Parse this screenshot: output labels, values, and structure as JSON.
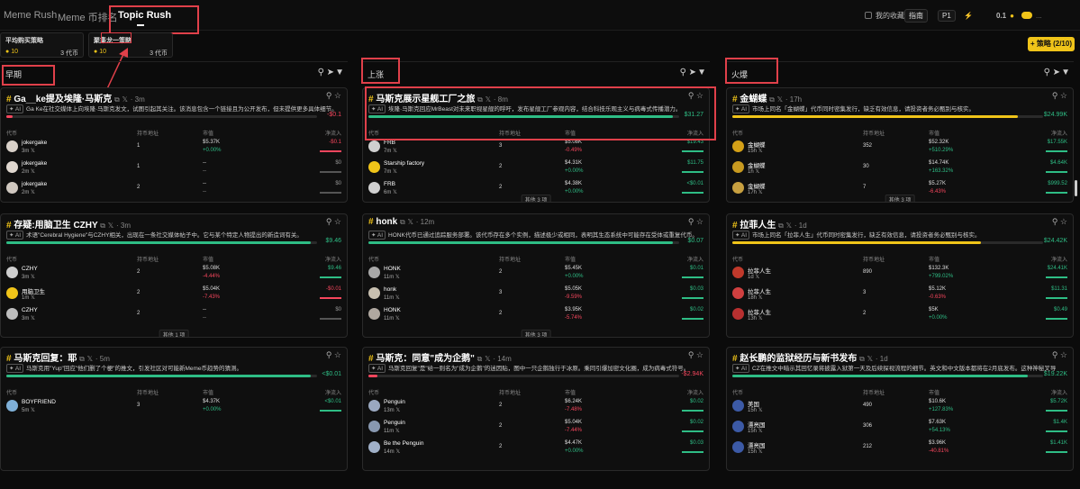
{
  "tabs": [
    {
      "label": "Meme Rush"
    },
    {
      "label": "Meme 币排名"
    },
    {
      "label": "Topic Rush"
    }
  ],
  "topright": {
    "fav": "我的收藏",
    "guide": "指南",
    "p1": "P1",
    "amount": "0.1",
    "toggle": "..."
  },
  "strategies": [
    {
      "name": "平均购买策略",
      "count": "10",
      "label": "3 代币"
    },
    {
      "name": "聚集龙一策略",
      "count": "10",
      "label": "3 代币"
    }
  ],
  "add_button": "+ 策略 (2/10)",
  "table_headers": [
    "代币",
    "持币地址",
    "市值",
    "净流入"
  ],
  "columns": [
    {
      "title": "早期",
      "cards": [
        {
          "title": "Ga__ke提及埃隆·马斯克",
          "ago": "3m",
          "desc": "Ga Ke在社交媒体上向埃隆·马斯克发文，试图引起其关注。该消息包含一个链接且为公开发布，但未提供更多具体细节。",
          "amount": "-$0.1",
          "amt_class": "down",
          "bar": 0.02,
          "bar_color": "#f6465d",
          "rows": [
            {
              "name": "jokergake",
              "age": "3m",
              "hold": "1",
              "mc": "$5.37K",
              "pct": "+0.00%",
              "pc": "up",
              "net": "-$0.1",
              "nc": "down",
              "av": "#d8d0c8"
            },
            {
              "name": "jokergake",
              "age": "2m",
              "hold": "1",
              "mc": "--",
              "pct": "--",
              "pc": "neu",
              "net": "$0",
              "nc": "neu",
              "av": "#e0d8d0"
            },
            {
              "name": "jokergake",
              "age": "2m",
              "hold": "2",
              "mc": "--",
              "pct": "--",
              "pc": "neu",
              "net": "$0",
              "nc": "neu",
              "av": "#d0c8c0"
            }
          ],
          "more": ""
        },
        {
          "title": "存疑:用脑卫生 CZHY",
          "ago": "3m",
          "desc": "术语\"Cerebral Hygiene\"与CZHY相关，出现在一条社交媒体帖子中。它与某个特定人物提出的新造词有关。",
          "amount": "$9.46",
          "amt_class": "up",
          "bar": 0.98,
          "bar_color": "#2ebd85",
          "rows": [
            {
              "name": "CZHY",
              "age": "3m",
              "hold": "2",
              "mc": "$5.08K",
              "pct": "-4.44%",
              "pc": "down",
              "net": "$9.46",
              "nc": "up",
              "av": "#cfcfcf"
            },
            {
              "name": "用脑卫生",
              "age": "1m",
              "hold": "2",
              "mc": "$5.04K",
              "pct": "-7.43%",
              "pc": "down",
              "net": "-$0.01",
              "nc": "down",
              "av": "#f0c419"
            },
            {
              "name": "CZHY",
              "age": "3m",
              "hold": "2",
              "mc": "--",
              "pct": "--",
              "pc": "neu",
              "net": "$0",
              "nc": "neu",
              "av": "#bdbdbd"
            }
          ],
          "more": "其他 1 项"
        },
        {
          "title": "马斯克回复：耶",
          "ago": "5m",
          "desc": "马斯克用\"Yup\"回应\"他们删了个梗\"的推文，引发社区对可能新Meme币趋势的猜测。",
          "amount": "<$0.01",
          "amt_class": "up",
          "bar": 0.98,
          "bar_color": "#2ebd85",
          "rows": [
            {
              "name": "BOYFRIEND",
              "age": "5m",
              "hold": "3",
              "mc": "$4.37K",
              "pct": "+0.00%",
              "pc": "up",
              "net": "<$0.01",
              "nc": "up",
              "av": "#7fb0d8"
            }
          ],
          "more": ""
        }
      ]
    },
    {
      "title": "上涨",
      "cards": [
        {
          "title": "马斯克展示星舰工厂之旅",
          "ago": "8m",
          "desc": "埃隆·马斯克回应MrBeast对未来职视星舰的呼吁，发布星舰工厂参观内容，结合科技乐观主义与病毒式传播潜力。",
          "amount": "$31.27",
          "amt_class": "up",
          "bar": 0.98,
          "bar_color": "#2ebd85",
          "rows": [
            {
              "name": "FRB",
              "age": "7m",
              "hold": "3",
              "mc": "$5.08K",
              "pct": "-0.49%",
              "pc": "down",
              "net": "$19.43",
              "nc": "up",
              "av": "#cfcfcf"
            },
            {
              "name": "Starship factory",
              "age": "7m",
              "hold": "2",
              "mc": "$4.31K",
              "pct": "+0.00%",
              "pc": "up",
              "net": "$11.75",
              "nc": "up",
              "av": "#f0c419"
            },
            {
              "name": "FRB",
              "age": "6m",
              "hold": "2",
              "mc": "$4.38K",
              "pct": "+0.00%",
              "pc": "up",
              "net": "<$0.01",
              "nc": "up",
              "av": "#d0d0d0"
            }
          ],
          "more": "其他 3 项"
        },
        {
          "title": "honk",
          "ago": "12m",
          "desc": "HONK代币已通过追踪服务部署。该代币存在多个实例，描述极少或相同，表明其生态系统中可能存在受体或重复代币。",
          "amount": "$0.07",
          "amt_class": "up",
          "bar": 0.98,
          "bar_color": "#2ebd85",
          "rows": [
            {
              "name": "HONK",
              "age": "11m",
              "hold": "2",
              "mc": "$5.45K",
              "pct": "+0.00%",
              "pc": "up",
              "net": "$0.01",
              "nc": "up",
              "av": "#a8a8a8"
            },
            {
              "name": "honk",
              "age": "11m",
              "hold": "3",
              "mc": "$5.05K",
              "pct": "-9.59%",
              "pc": "down",
              "net": "$0.03",
              "nc": "up",
              "av": "#c8c0b0"
            },
            {
              "name": "HONK",
              "age": "11m",
              "hold": "2",
              "mc": "$3.95K",
              "pct": "-5.74%",
              "pc": "down",
              "net": "$0.02",
              "nc": "up",
              "av": "#b0a8a0"
            }
          ],
          "more": "其他 3 项"
        },
        {
          "title": "马斯克：同意\"成为企鹅\"",
          "ago": "14m",
          "desc": "马斯克回复\"是\"给一则名为\"成为企鹅\"的迷因贴，图中一只企鹅独行于冰原。乘同引爆加密文化圈，成为病毒式符号。",
          "amount": "-$2.94K",
          "amt_class": "down",
          "bar": 0.03,
          "bar_color": "#f6465d",
          "rows": [
            {
              "name": "Penguin",
              "age": "13m",
              "hold": "2",
              "mc": "$6.24K",
              "pct": "-7.48%",
              "pc": "down",
              "net": "$0.02",
              "nc": "up",
              "av": "#9aa8c0"
            },
            {
              "name": "Penguin",
              "age": "11m",
              "hold": "2",
              "mc": "$5.04K",
              "pct": "-7.44%",
              "pc": "down",
              "net": "$0.02",
              "nc": "up",
              "av": "#8898b0"
            },
            {
              "name": "Be the Penguin",
              "age": "14m",
              "hold": "2",
              "mc": "$4.47K",
              "pct": "+0.00%",
              "pc": "up",
              "net": "$0.03",
              "nc": "up",
              "av": "#a0b0c8"
            }
          ],
          "more": ""
        }
      ]
    },
    {
      "title": "火爆",
      "cards": [
        {
          "title": "金蝴蝶",
          "ago": "17h",
          "desc": "市场上同名「金蝴蝶」代币同时密集发行，缺乏有效信息，请投资者务必甄别与核实。",
          "amount": "$24.99K",
          "amt_class": "up",
          "bar": 0.92,
          "bar_color": "#f0c419",
          "rows": [
            {
              "name": "金蝴蝶",
              "age": "15h",
              "hold": "352",
              "mc": "$52.32K",
              "pct": "+510.29%",
              "pc": "up",
              "net": "$17.55K",
              "nc": "up",
              "av": "#d4a017"
            },
            {
              "name": "金蝴蝶",
              "age": "1h",
              "hold": "30",
              "mc": "$14.74K",
              "pct": "+163.32%",
              "pc": "up",
              "net": "$4.64K",
              "nc": "up",
              "av": "#c89a20"
            },
            {
              "name": "金蝴蝶",
              "age": "17h",
              "hold": "7",
              "mc": "$5.27K",
              "pct": "-6.43%",
              "pc": "down",
              "net": "$999.52",
              "nc": "up",
              "av": "#c8a040"
            }
          ],
          "more": "其他 3 项"
        },
        {
          "title": "拉菲人生",
          "ago": "1d",
          "desc": "市场上同名「拉菲人生」代币同时密集发行，缺乏有效信息，请投资者务必甄别与核实。",
          "amount": "$24.42K",
          "amt_class": "up",
          "bar": 0.8,
          "bar_color": "#f0c419",
          "rows": [
            {
              "name": "拉菲人生",
              "age": "1d",
              "hold": "890",
              "mc": "$132.3K",
              "pct": "+799.02%",
              "pc": "up",
              "net": "$24.41K",
              "nc": "up",
              "av": "#c0392b"
            },
            {
              "name": "拉菲人生",
              "age": "18h",
              "hold": "3",
              "mc": "$5.12K",
              "pct": "-0.63%",
              "pc": "down",
              "net": "$11.31",
              "nc": "up",
              "av": "#d04040"
            },
            {
              "name": "拉菲人生",
              "age": "13h",
              "hold": "2",
              "mc": "$5K",
              "pct": "+0.00%",
              "pc": "up",
              "net": "$0.49",
              "nc": "up",
              "av": "#b83030"
            }
          ],
          "more": ""
        },
        {
          "title": "赵长鹏的监狱经历与新书发布",
          "ago": "1d",
          "desc": "CZ在推文中暗示其回忆录将披露入狱第一天及后续探视流程的细节。英文和中文版本都将在2月底发布。这种神秘叉导",
          "amount": "$19.22K",
          "amt_class": "up",
          "bar": 0.95,
          "bar_color": "#2ebd85",
          "rows": [
            {
              "name": "美国",
              "age": "15h",
              "hold": "490",
              "mc": "$10.6K",
              "pct": "+127.83%",
              "pc": "up",
              "net": "$5.72K",
              "nc": "up",
              "av": "#3c5aa6"
            },
            {
              "name": "漂亮国",
              "age": "15h",
              "hold": "306",
              "mc": "$7.63K",
              "pct": "+54.13%",
              "pc": "up",
              "net": "$1.4K",
              "nc": "up",
              "av": "#3c5aa6"
            },
            {
              "name": "漂亮国",
              "age": "15h",
              "hold": "212",
              "mc": "$3.96K",
              "pct": "-40.81%",
              "pc": "down",
              "net": "$1.41K",
              "nc": "up",
              "av": "#3c5aa6"
            }
          ],
          "more": ""
        }
      ]
    }
  ]
}
